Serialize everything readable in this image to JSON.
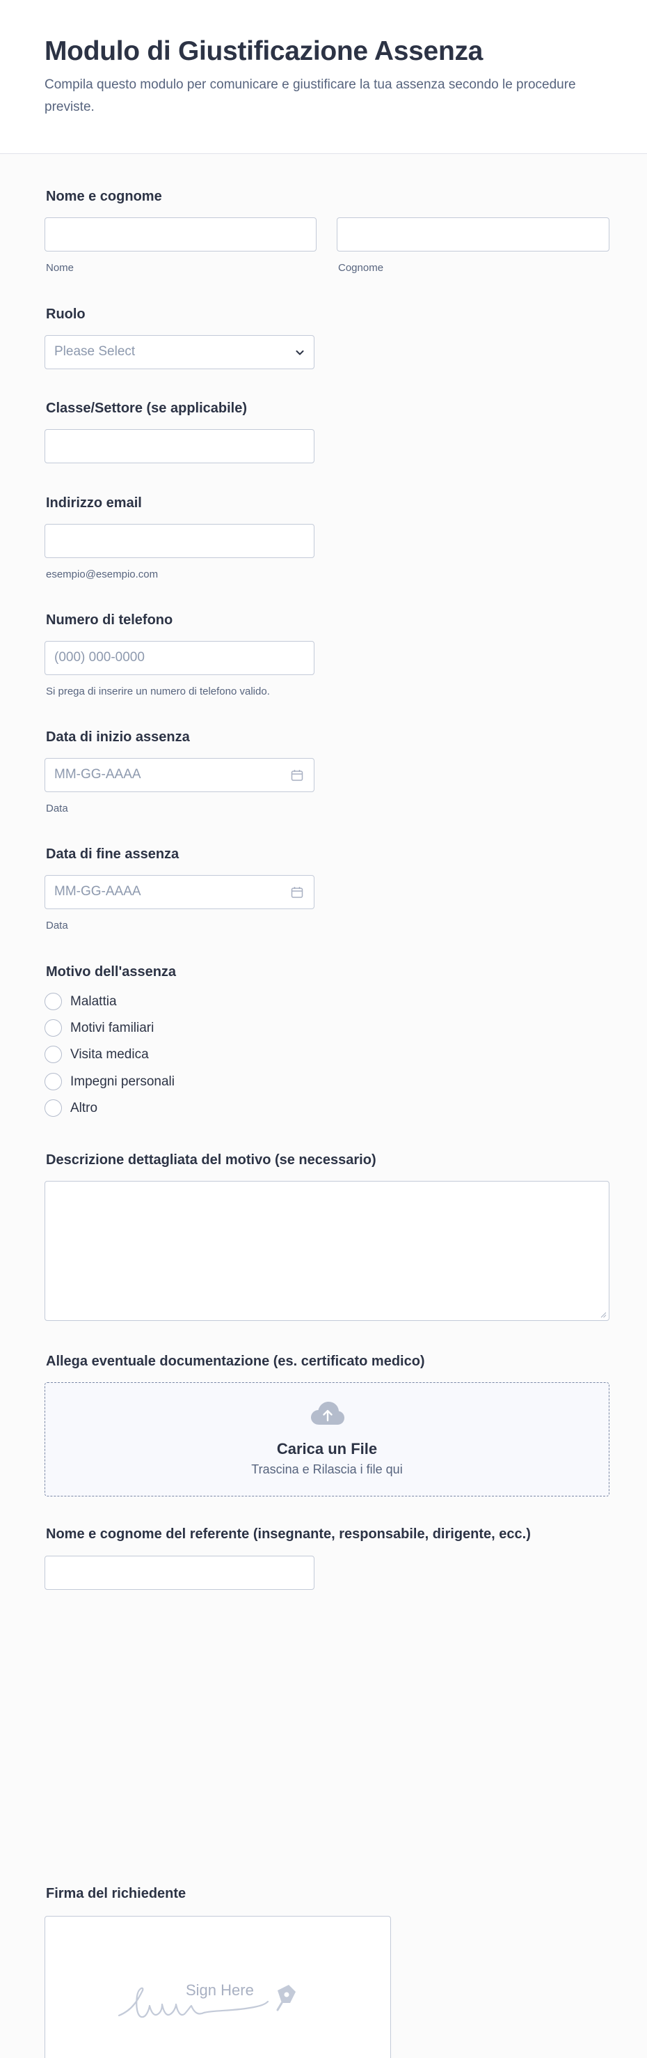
{
  "header": {
    "title": "Modulo di Giustificazione Assenza",
    "subtitle": "Compila questo modulo per comunicare e giustificare la tua assenza secondo le procedure previste."
  },
  "full_name": {
    "label": "Nome e cognome",
    "first_sub": "Nome",
    "last_sub": "Cognome"
  },
  "role": {
    "label": "Ruolo",
    "placeholder": "Please Select",
    "icon": "chevron-down-icon"
  },
  "class_sector": {
    "label": "Classe/Settore (se applicabile)"
  },
  "email": {
    "label": "Indirizzo email",
    "sub": "esempio@esempio.com"
  },
  "phone": {
    "label": "Numero di telefono",
    "placeholder": "(000) 000-0000",
    "sub": "Si prega di inserire un numero di telefono valido."
  },
  "start_date": {
    "label": "Data di inizio assenza",
    "placeholder": "MM-GG-AAAA",
    "sub": "Data",
    "icon": "calendar-icon"
  },
  "end_date": {
    "label": "Data di fine assenza",
    "placeholder": "MM-GG-AAAA",
    "sub": "Data",
    "icon": "calendar-icon"
  },
  "reason": {
    "label": "Motivo dell'assenza",
    "options": [
      "Malattia",
      "Motivi familiari",
      "Visita medica",
      "Impegni personali",
      "Altro"
    ]
  },
  "description": {
    "label": "Descrizione dettagliata del motivo (se necessario)"
  },
  "upload": {
    "label": "Allega eventuale documentazione (es. certificato medico)",
    "title": "Carica un File",
    "subtitle": "Trascina e Rilascia i file qui",
    "icon": "cloud-upload-icon"
  },
  "referent": {
    "label": "Nome e cognome del referente (insegnante, responsabile, dirigente, ecc.)"
  },
  "signature": {
    "label": "Firma del richiedente",
    "placeholder": "Sign Here",
    "icon": "pen-icon"
  },
  "colors": {
    "text": "#2c3345",
    "muted": "#57647e",
    "placeholder": "#8d99ae",
    "border": "#c3cad8",
    "upload_bg": "#f8f9fd"
  }
}
